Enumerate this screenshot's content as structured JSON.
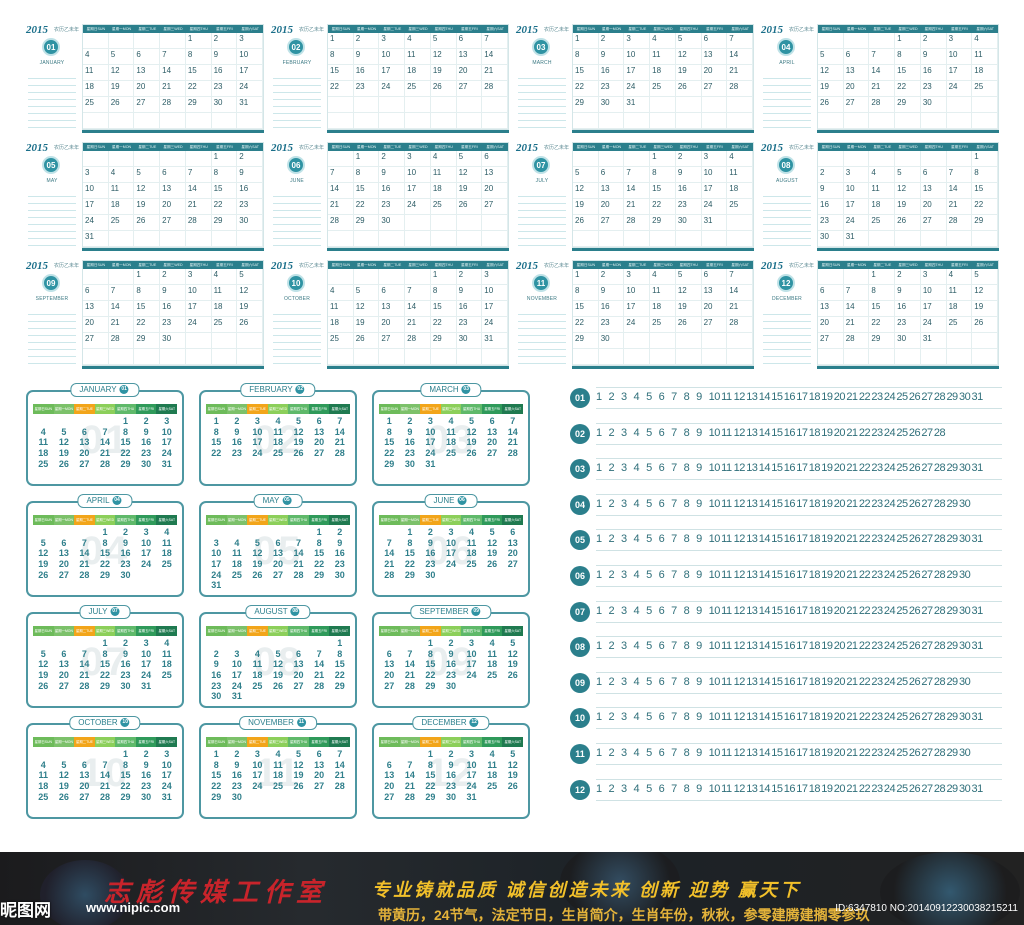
{
  "wall": {
    "year": "2015",
    "subtitle": "农历乙未年",
    "weekday_headers": [
      "星期日SUN",
      "星期一MON",
      "星期二TUE",
      "星期三WED",
      "星期四THU",
      "星期五FRI",
      "星期六SAT"
    ],
    "months": [
      {
        "badge": "01",
        "name": "JANUARY",
        "start": 4,
        "days": 31
      },
      {
        "badge": "02",
        "name": "FEBRUARY",
        "start": 0,
        "days": 28
      },
      {
        "badge": "03",
        "name": "MARCH",
        "start": 0,
        "days": 31
      },
      {
        "badge": "04",
        "name": "APRIL",
        "start": 3,
        "days": 30
      },
      {
        "badge": "05",
        "name": "MAY",
        "start": 5,
        "days": 31
      },
      {
        "badge": "06",
        "name": "JUNE",
        "start": 1,
        "days": 30
      },
      {
        "badge": "07",
        "name": "JULY",
        "start": 3,
        "days": 31
      },
      {
        "badge": "08",
        "name": "AUGUST",
        "start": 6,
        "days": 31
      },
      {
        "badge": "09",
        "name": "SEPTEMBER",
        "start": 2,
        "days": 30
      },
      {
        "badge": "10",
        "name": "OCTOBER",
        "start": 4,
        "days": 31
      },
      {
        "badge": "11",
        "name": "NOVEMBER",
        "start": 0,
        "days": 30
      },
      {
        "badge": "12",
        "name": "DECEMBER",
        "start": 2,
        "days": 31
      }
    ]
  },
  "desk": {
    "header_colors": [
      "#6dbb5a",
      "#7cc16a",
      "#f2a51a",
      "#8ccf5a",
      "#5fb96a",
      "#2f9a5a",
      "#1f7a50"
    ],
    "months": [
      {
        "name": "JANUARY",
        "badge": "01"
      },
      {
        "name": "FEBRUARY",
        "badge": "02"
      },
      {
        "name": "MARCH",
        "badge": "03"
      },
      {
        "name": "APRIL",
        "badge": "04"
      },
      {
        "name": "MAY",
        "badge": "05"
      },
      {
        "name": "JUNE",
        "badge": "06"
      },
      {
        "name": "JULY",
        "badge": "07"
      },
      {
        "name": "AUGUST",
        "badge": "08"
      },
      {
        "name": "SEPTEMBER",
        "badge": "09"
      },
      {
        "name": "OCTOBER",
        "badge": "10"
      },
      {
        "name": "NOVEMBER",
        "badge": "11"
      },
      {
        "name": "DECEMBER",
        "badge": "12"
      }
    ]
  },
  "strips": {
    "months": [
      {
        "badge": "01",
        "days": 31
      },
      {
        "badge": "02",
        "days": 28
      },
      {
        "badge": "03",
        "days": 31
      },
      {
        "badge": "04",
        "days": 30
      },
      {
        "badge": "05",
        "days": 31
      },
      {
        "badge": "06",
        "days": 30
      },
      {
        "badge": "07",
        "days": 31
      },
      {
        "badge": "08",
        "days": 31
      },
      {
        "badge": "09",
        "days": 30
      },
      {
        "badge": "10",
        "days": 31
      },
      {
        "badge": "11",
        "days": 30
      },
      {
        "badge": "12",
        "days": 31
      }
    ]
  },
  "banner": {
    "studio": "志彪传媒工作室",
    "slogan": "专业铸就品质   诚信创造未来   创新 迎势 赢天下",
    "features": "带黄历，24节气，法定节日，生肖简介，生肖年份，秋秋，参零建腾建搁零参玖"
  },
  "watermark": {
    "site": "昵图网",
    "url": "www.nipic.com",
    "id": "ID:6347810 NO:20140912230038215211"
  },
  "colors": {
    "teal": "#2b7f8c",
    "banner_red": "#c8242b",
    "banner_gold": "#f2c02a"
  }
}
